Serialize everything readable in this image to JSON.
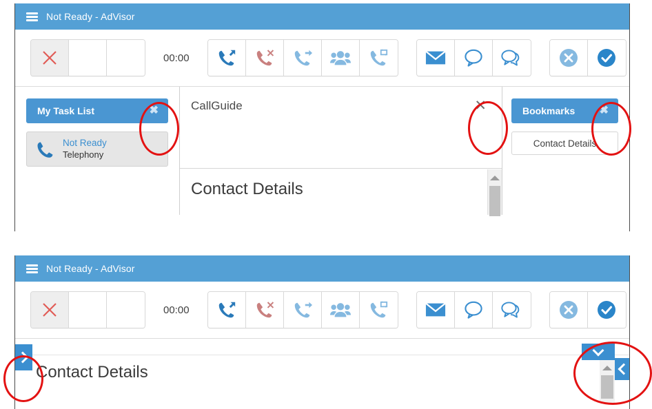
{
  "window_top": {
    "titlebar": {
      "menu_icon": "hamburger-icon",
      "title": "Not Ready - AdVisor"
    },
    "toolbar": {
      "state_buttons": [
        {
          "name": "not-ready-state",
          "icon": "red-x-icon",
          "label": "",
          "active": true
        },
        {
          "name": "state-slot-2",
          "icon": "",
          "label": "",
          "active": false
        },
        {
          "name": "state-slot-3",
          "icon": "",
          "label": "",
          "active": false
        }
      ],
      "timer": "00:00",
      "call_buttons": [
        {
          "name": "make-call",
          "icon": "phone-outgoing-icon"
        },
        {
          "name": "end-call",
          "icon": "phone-hangup-icon"
        },
        {
          "name": "transfer-call",
          "icon": "phone-transfer-icon"
        },
        {
          "name": "conference-call",
          "icon": "conference-people-icon"
        },
        {
          "name": "consult-call",
          "icon": "phone-consult-icon"
        }
      ],
      "message_buttons": [
        {
          "name": "email",
          "icon": "envelope-icon"
        },
        {
          "name": "chat",
          "icon": "chat-bubble-icon"
        },
        {
          "name": "multi-chat",
          "icon": "double-chat-bubble-icon"
        }
      ],
      "action_buttons": [
        {
          "name": "reject",
          "icon": "circle-x-icon"
        },
        {
          "name": "accept",
          "icon": "circle-check-icon"
        }
      ]
    },
    "task_list_panel": {
      "title": "My Task List",
      "close_label": "✖",
      "task": {
        "icon": "phone-icon",
        "status": "Not Ready",
        "channel": "Telephony"
      }
    },
    "callguide_panel": {
      "title": "CallGuide",
      "close_label": "✕"
    },
    "contact_details_section": {
      "title": "Contact Details"
    },
    "bookmarks_panel": {
      "title": "Bookmarks",
      "close_label": "✖",
      "items": [
        {
          "label": "Contact Details"
        }
      ]
    }
  },
  "window_bottom": {
    "titlebar": {
      "menu_icon": "hamburger-icon",
      "title": "Not Ready - AdVisor"
    },
    "toolbar": {
      "state_buttons": [
        {
          "name": "not-ready-state",
          "icon": "red-x-icon",
          "label": "",
          "active": true
        },
        {
          "name": "state-slot-2",
          "icon": "",
          "label": "",
          "active": false
        },
        {
          "name": "state-slot-3",
          "icon": "",
          "label": "",
          "active": false
        }
      ],
      "timer": "00:00",
      "call_buttons": [
        {
          "name": "make-call",
          "icon": "phone-outgoing-icon"
        },
        {
          "name": "end-call",
          "icon": "phone-hangup-icon"
        },
        {
          "name": "transfer-call",
          "icon": "phone-transfer-icon"
        },
        {
          "name": "conference-call",
          "icon": "conference-people-icon"
        },
        {
          "name": "consult-call",
          "icon": "phone-consult-icon"
        }
      ],
      "message_buttons": [
        {
          "name": "email",
          "icon": "envelope-icon"
        },
        {
          "name": "chat",
          "icon": "chat-bubble-icon"
        },
        {
          "name": "multi-chat",
          "icon": "double-chat-bubble-icon"
        }
      ],
      "action_buttons": [
        {
          "name": "reject",
          "icon": "circle-x-icon"
        },
        {
          "name": "accept",
          "icon": "circle-check-icon"
        }
      ]
    },
    "expand_left_tab": {
      "icon": "chevron-right-icon"
    },
    "collapse_right_tab": {
      "icon": "chevron-left-icon"
    },
    "down_tab": {
      "icon": "chevron-down-icon"
    },
    "contact_details_section": {
      "title": "Contact Details"
    }
  },
  "colors": {
    "titlebar_blue": "#54a0d5",
    "panel_blue": "#4a96d2",
    "tab_blue": "#3b8fd0",
    "icon_blue_dark": "#2a7ab9",
    "icon_blue_light": "#85b9e0",
    "icon_red": "#c9807f",
    "state_x_red": "#e15b55",
    "annotation_red": "#e31212"
  }
}
